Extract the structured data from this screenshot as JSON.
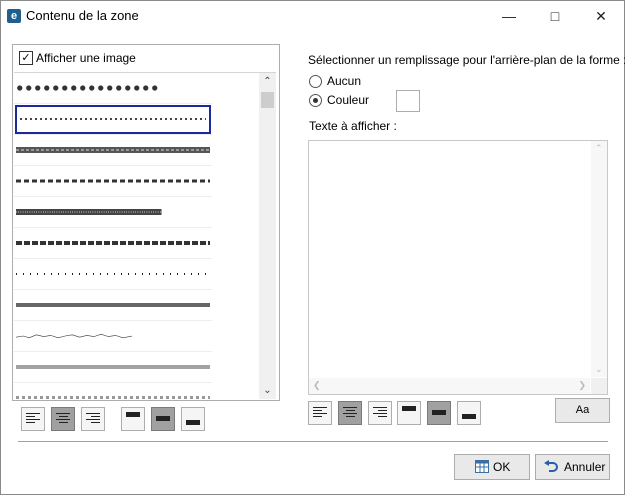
{
  "window": {
    "title": "Contenu de la zone",
    "icon": "app-e-icon",
    "controls": {
      "minimize": "minimize-icon",
      "maximize": "maximize-icon",
      "close": "close-icon"
    }
  },
  "image_panel": {
    "checkbox_label": "Afficher une image",
    "checked": true,
    "pattern_count_visible": 11,
    "selected_index": 1
  },
  "fill": {
    "label": "Sélectionner un remplissage pour l'arrière-plan de la forme :",
    "options": [
      {
        "label": "Aucun",
        "selected": false
      },
      {
        "label": "Couleur",
        "selected": true
      }
    ]
  },
  "text_panel": {
    "label": "Texte à afficher :",
    "value": ""
  },
  "font_button": {
    "label": "Aa"
  },
  "buttons": {
    "ok": "OK",
    "cancel": "Annuler"
  },
  "colors": {
    "accent_selection": "#1a2a9a",
    "toggle_active": "#a0a0a0",
    "app_icon": "#1e5f8f"
  }
}
